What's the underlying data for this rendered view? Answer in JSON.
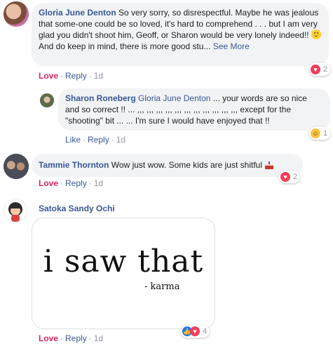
{
  "comments": [
    {
      "author": "Gloria June Denton",
      "text_part1": "So very sorry, so disrespectful. Maybe he was jealous that some-one could be so loved, it's hard to comprehend . . . but I am very glad you didn't shoot him, Geoff, or Sharon would be very lonely indeed!!",
      "text_part2": "And do keep in mind, there is more good stu...",
      "see_more": "See More",
      "action_reaction": "Love",
      "action_reply": "Reply",
      "time": "1d",
      "reaction_count": "2"
    },
    {
      "author": "Sharon Roneberg",
      "mention": "Gloria June Denton",
      "text": "... your words are so nice and so correct !! ... ,,, ,,, ,,, ,,, ,,, ,,, ,,, ,,, ,,, ,,, ,,, except for the \"shooting\" bit ... ... I'm sure I would have enjoyed that !!",
      "action_reaction": "Like",
      "action_reply": "Reply",
      "time": "1d",
      "reaction_count": "1"
    },
    {
      "author": "Tammie Thornton",
      "text": "Wow just wow. Some kids are just shitful",
      "action_reaction": "Love",
      "action_reply": "Reply",
      "time": "1d",
      "reaction_count": "2"
    },
    {
      "author": "Satoka Sandy Ochi",
      "image_text_main": "i saw that",
      "image_text_sub": "- karma",
      "action_reaction": "Love",
      "action_reply": "Reply",
      "time": "1d",
      "reaction_count": "4"
    }
  ],
  "colors": {
    "link": "#385898",
    "love": "#e0245e",
    "bubble": "#f2f3f5"
  },
  "icons": [
    "heart-icon",
    "haha-icon",
    "like-icon",
    "smile-emoji-icon",
    "cake-emoji-icon"
  ]
}
